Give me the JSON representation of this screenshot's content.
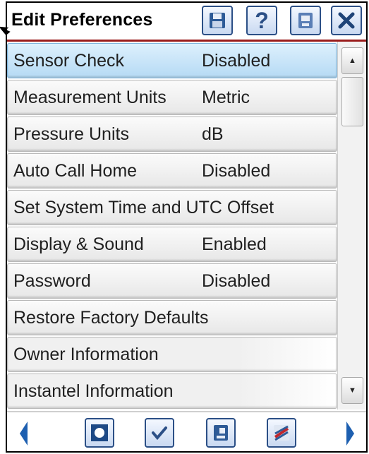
{
  "window": {
    "title": "Edit Preferences"
  },
  "title_buttons": [
    {
      "icon": "save-disk-icon"
    },
    {
      "icon": "help-question-icon"
    },
    {
      "icon": "device-icon"
    },
    {
      "icon": "close-icon"
    }
  ],
  "settings": [
    {
      "label": "Sensor Check",
      "value": "Disabled",
      "selected": true
    },
    {
      "label": "Measurement Units",
      "value": "Metric"
    },
    {
      "label": "Pressure Units",
      "value": "dB"
    },
    {
      "label": "Auto Call Home",
      "value": "Disabled"
    },
    {
      "label": "Set System Time and UTC Offset",
      "value": ""
    },
    {
      "label": "Display & Sound",
      "value": "Enabled"
    },
    {
      "label": "Password",
      "value": "Disabled"
    },
    {
      "label": "Restore Factory Defaults",
      "value": ""
    },
    {
      "label": "Owner Information",
      "value": ""
    },
    {
      "label": "Instantel Information",
      "value": ""
    }
  ],
  "bottom_toolbar": [
    {
      "icon": "left-arrow-icon"
    },
    {
      "icon": "record-icon"
    },
    {
      "icon": "check-icon"
    },
    {
      "icon": "contact-card-icon"
    },
    {
      "icon": "chart-icon"
    },
    {
      "icon": "right-arrow-icon"
    }
  ],
  "colors": {
    "accent_line": "#9a1c1c",
    "button_border": "#2b4f86",
    "selected_row": "#b5daf4",
    "arrow_blue": "#1d5fb0"
  }
}
